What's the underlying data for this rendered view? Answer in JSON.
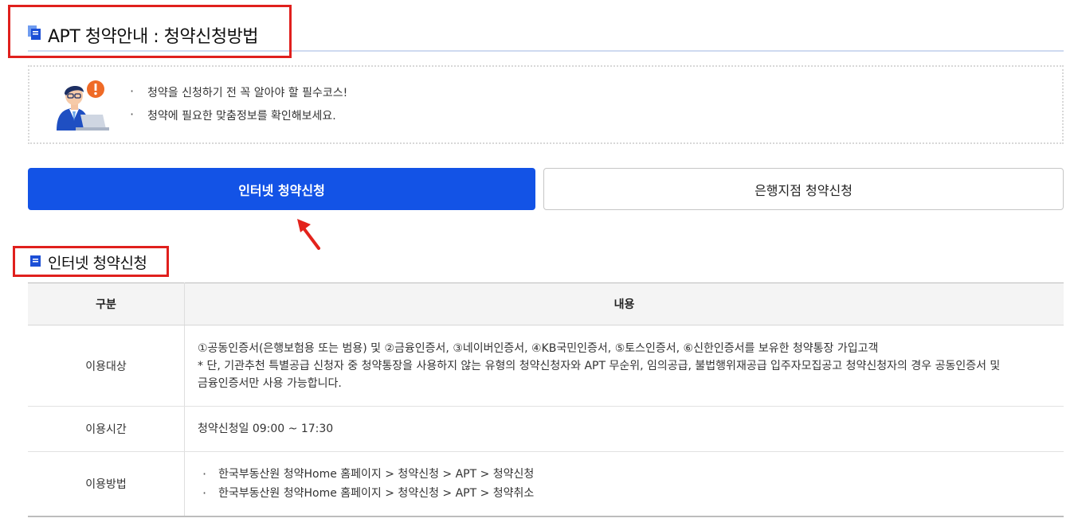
{
  "header": {
    "title": "APT 청약안내 : 청약신청방법"
  },
  "notice": {
    "items": [
      "청약을 신청하기 전 꼭 알아야 할 필수코스!",
      "청약에 필요한 맞춤정보를 확인해보세요."
    ]
  },
  "buttons": {
    "internet": "인터넷 청약신청",
    "bank": "은행지점 청약신청"
  },
  "section": {
    "title": "인터넷 청약신청"
  },
  "table": {
    "headers": [
      "구분",
      "내용"
    ],
    "rows": [
      {
        "label": "이용대상",
        "lines": [
          "①공동인증서(은행보험용 또는 범용) 및 ②금융인증서, ③네이버인증서, ④KB국민인증서, ⑤토스인증서, ⑥신한인증서를 보유한 청약통장 가입고객",
          "* 단, 기관추천 특별공급 신청자 중 청약통장을 사용하지 않는 유형의 청약신청자와 APT 무순위, 임의공급, 불법행위재공급 입주자모집공고 청약신청자의 경우 공동인증서 및",
          "금융인증서만 사용 가능합니다."
        ]
      },
      {
        "label": "이용시간",
        "text": "청약신청일 09:00 ~ 17:30"
      },
      {
        "label": "이용방법",
        "items": [
          "한국부동산원 청약Home 홈페이지 > 청약신청 > APT > 청약신청",
          "한국부동산원 청약Home 홈페이지 > 청약신청 > APT > 청약취소"
        ]
      }
    ]
  },
  "colors": {
    "primary": "#1353e6",
    "highlight_red": "#e0201d",
    "arrow_red": "#e3231c"
  }
}
